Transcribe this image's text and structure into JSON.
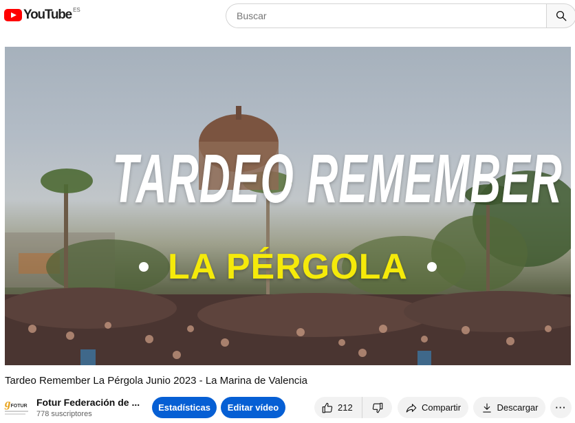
{
  "header": {
    "logo_text": "YouTube",
    "country_code": "ES",
    "search_placeholder": "Buscar"
  },
  "video": {
    "overlay_title": "TARDEO REMEMBER",
    "overlay_subtitle": "LA PÉRGOLA",
    "title": "Tardeo Remember La Pérgola Junio 2023 - La Marina de Valencia"
  },
  "channel": {
    "avatar_text": "FOTUR",
    "name": "Fotur Federación de ...",
    "subscribers": "778 suscriptores"
  },
  "actions": {
    "stats_label": "Estadísticas",
    "edit_label": "Editar vídeo",
    "likes": "212",
    "share_label": "Compartir",
    "download_label": "Descargar",
    "more_label": "···"
  },
  "icons": [
    "youtube-logo-icon",
    "search-icon",
    "thumbs-up-icon",
    "thumbs-down-icon",
    "share-icon",
    "download-icon",
    "more-icon"
  ],
  "colors": {
    "brand_red": "#ff0000",
    "primary_blue": "#065fd4",
    "subtitle_yellow": "#f5ea0a"
  }
}
